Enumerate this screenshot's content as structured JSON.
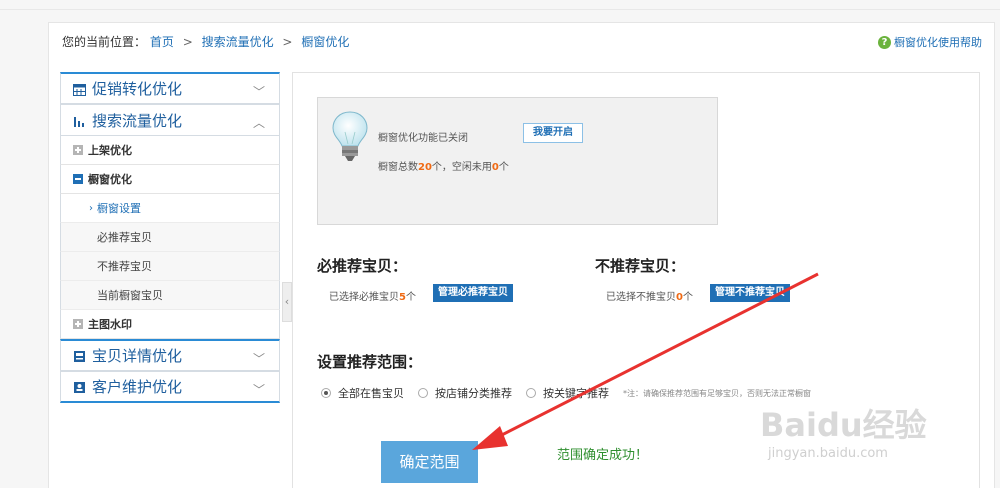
{
  "breadcrumb": {
    "label": "您的当前位置：",
    "items": [
      "首页",
      "搜索流量优化",
      "橱窗优化"
    ],
    "sep": ">"
  },
  "help": {
    "label": "橱窗优化使用帮助",
    "icon": "question-circle-icon"
  },
  "sidebar": {
    "sections": [
      {
        "label": "促销转化优化",
        "icon": "calendar-icon",
        "state": "collapsed"
      },
      {
        "label": "搜索流量优化",
        "icon": "bar-chart-icon",
        "state": "expanded"
      },
      {
        "label": "宝贝详情优化",
        "icon": "document-icon",
        "state": "collapsed"
      },
      {
        "label": "客户维护优化",
        "icon": "contact-icon",
        "state": "collapsed"
      }
    ],
    "sub_items": {
      "shelf": "上架优化",
      "window": "橱窗优化",
      "window_settings": "橱窗设置",
      "must_recommend": "必推荐宝贝",
      "not_recommend": "不推荐宝贝",
      "current_window": "当前橱窗宝贝",
      "watermark": "主图水印"
    }
  },
  "status": {
    "off_text": "橱窗优化功能已关闭",
    "open_button": "我要开启",
    "total_prefix": "橱窗总数",
    "total": "20",
    "total_mid": "个，空闲未用",
    "idle": "0",
    "total_suffix": "个"
  },
  "must": {
    "title": "必推荐宝贝：",
    "selected_prefix": "已选择必推宝贝",
    "count": "5",
    "suffix": "个",
    "button": "管理必推荐宝贝"
  },
  "not": {
    "title": "不推荐宝贝：",
    "selected_prefix": "已选择不推宝贝",
    "count": "0",
    "suffix": "个",
    "button": "管理不推荐宝贝"
  },
  "range": {
    "title": "设置推荐范围：",
    "options": [
      "全部在售宝贝",
      "按店铺分类推荐",
      "按关键字推荐"
    ],
    "selected": 0,
    "note": "*注：请确保推荐范围有足够宝贝，否则无法正常橱窗"
  },
  "confirm_button": "确定范围",
  "success_text": "范围确定成功！",
  "watermark": {
    "brand": "Baidu经验",
    "url": "jingyan.baidu.com"
  },
  "colors": {
    "accent": "#1f6fb5",
    "highlight": "#f06a14",
    "success": "#2f8f2f",
    "arrow": "#e8322f"
  }
}
